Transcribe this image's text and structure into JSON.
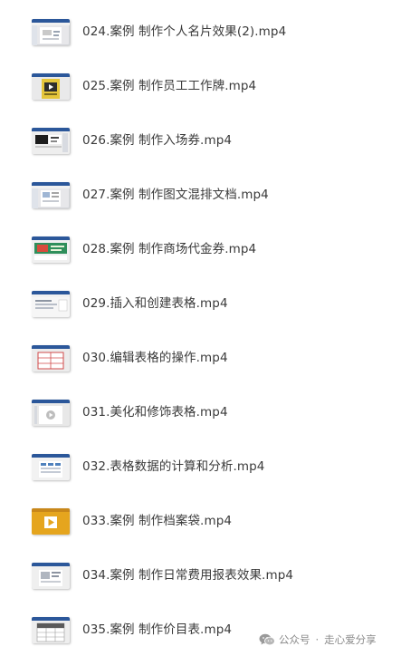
{
  "files": [
    {
      "name": "024.案例 制作个人名片效果(2).mp4",
      "thumbnail": "doc-preview-icon"
    },
    {
      "name": "025.案例 制作员工工作牌.mp4",
      "thumbnail": "yellow-badge-play-icon"
    },
    {
      "name": "026.案例 制作入场券.mp4",
      "thumbnail": "black-white-doc-icon"
    },
    {
      "name": "027.案例 制作图文混排文档.mp4",
      "thumbnail": "doc-preview-icon"
    },
    {
      "name": "028.案例 制作商场代金券.mp4",
      "thumbnail": "green-banner-doc-icon"
    },
    {
      "name": "029.插入和创建表格.mp4",
      "thumbnail": "doc-preview-icon"
    },
    {
      "name": "030.编辑表格的操作.mp4",
      "thumbnail": "red-table-doc-icon"
    },
    {
      "name": "031.美化和修饰表格.mp4",
      "thumbnail": "play-doc-icon"
    },
    {
      "name": "032.表格数据的计算和分析.mp4",
      "thumbnail": "doc-preview-icon"
    },
    {
      "name": "033.案例 制作档案袋.mp4",
      "thumbnail": "orange-play-icon"
    },
    {
      "name": "034.案例 制作日常费用报表效果.mp4",
      "thumbnail": "doc-preview-icon"
    },
    {
      "name": "035.案例 制作价目表.mp4",
      "thumbnail": "table-doc-icon"
    }
  ],
  "watermark": {
    "icon": "wechat-icon",
    "account": "公众号",
    "separator": "·",
    "name": "走心爱分享"
  },
  "colors": {
    "text": "#3a3a3a",
    "window_blue": "#2b579a",
    "watermark": "#8a8a8a"
  }
}
